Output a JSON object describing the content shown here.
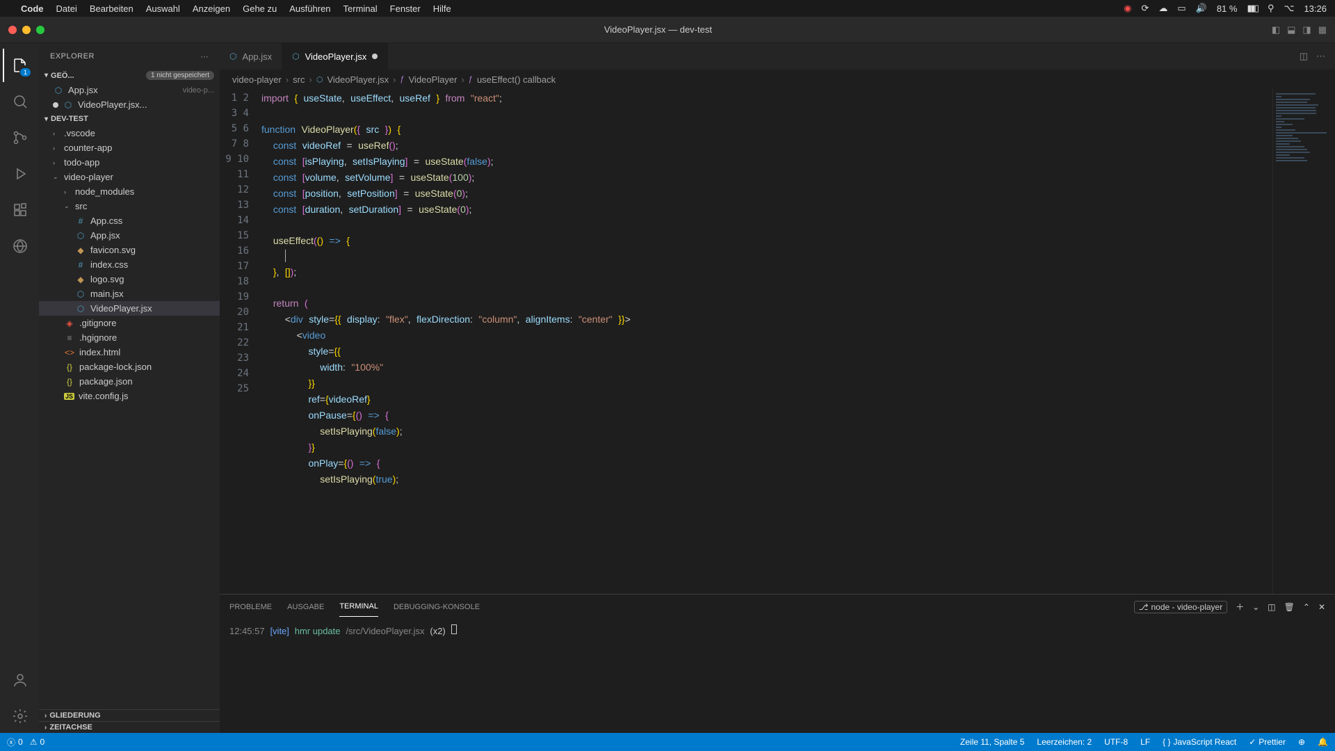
{
  "macos": {
    "app": "Code",
    "menus": [
      "Datei",
      "Bearbeiten",
      "Auswahl",
      "Anzeigen",
      "Gehe zu",
      "Ausführen",
      "Terminal",
      "Fenster",
      "Hilfe"
    ],
    "battery": "81 %",
    "time": "13:26"
  },
  "window": {
    "title": "VideoPlayer.jsx — dev-test"
  },
  "sidebar": {
    "title": "EXPLORER",
    "open_editors_label": "GEÖ...",
    "unsaved_badge": "1 nicht gespeichert",
    "open_editors": [
      {
        "label": "App.jsx",
        "sub": "video-p...",
        "dirty": false
      },
      {
        "label": "VideoPlayer.jsx...",
        "sub": "",
        "dirty": true
      }
    ],
    "workspace": "DEV-TEST",
    "tree": [
      {
        "type": "folder",
        "label": ".vscode",
        "indent": 1,
        "expanded": false
      },
      {
        "type": "folder",
        "label": "counter-app",
        "indent": 1,
        "expanded": false
      },
      {
        "type": "folder",
        "label": "todo-app",
        "indent": 1,
        "expanded": false
      },
      {
        "type": "folder",
        "label": "video-player",
        "indent": 1,
        "expanded": true
      },
      {
        "type": "folder",
        "label": "node_modules",
        "indent": 2,
        "expanded": false
      },
      {
        "type": "folder",
        "label": "src",
        "indent": 2,
        "expanded": true
      },
      {
        "type": "file",
        "label": "App.css",
        "indent": 3,
        "icon": "css"
      },
      {
        "type": "file",
        "label": "App.jsx",
        "indent": 3,
        "icon": "react"
      },
      {
        "type": "file",
        "label": "favicon.svg",
        "indent": 3,
        "icon": "svg"
      },
      {
        "type": "file",
        "label": "index.css",
        "indent": 3,
        "icon": "css"
      },
      {
        "type": "file",
        "label": "logo.svg",
        "indent": 3,
        "icon": "svg"
      },
      {
        "type": "file",
        "label": "main.jsx",
        "indent": 3,
        "icon": "react"
      },
      {
        "type": "file",
        "label": "VideoPlayer.jsx",
        "indent": 3,
        "icon": "react",
        "active": true
      },
      {
        "type": "file",
        "label": ".gitignore",
        "indent": 2,
        "icon": "git"
      },
      {
        "type": "file",
        "label": ".hgignore",
        "indent": 2,
        "icon": "txt"
      },
      {
        "type": "file",
        "label": "index.html",
        "indent": 2,
        "icon": "html"
      },
      {
        "type": "file",
        "label": "package-lock.json",
        "indent": 2,
        "icon": "json"
      },
      {
        "type": "file",
        "label": "package.json",
        "indent": 2,
        "icon": "json"
      },
      {
        "type": "file",
        "label": "vite.config.js",
        "indent": 2,
        "icon": "js"
      }
    ],
    "outline": "GLIEDERUNG",
    "timeline": "ZEITACHSE"
  },
  "tabs": [
    {
      "label": "App.jsx",
      "active": false,
      "dirty": false
    },
    {
      "label": "VideoPlayer.jsx",
      "active": true,
      "dirty": true
    }
  ],
  "breadcrumb": [
    "video-player",
    "src",
    "VideoPlayer.jsx",
    "VideoPlayer",
    "useEffect() callback"
  ],
  "code": {
    "lines": [
      1,
      2,
      3,
      4,
      5,
      6,
      7,
      8,
      9,
      10,
      11,
      12,
      13,
      14,
      15,
      16,
      17,
      18,
      19,
      20,
      21,
      22,
      23,
      24,
      25
    ]
  },
  "panel": {
    "tabs": [
      "PROBLEME",
      "AUSGABE",
      "TERMINAL",
      "DEBUGGING-KONSOLE"
    ],
    "active_tab": "TERMINAL",
    "task_label": "node - video-player",
    "terminal": {
      "time": "12:45:57",
      "tag": "[vite]",
      "msg": "hmr update",
      "path": "/src/VideoPlayer.jsx",
      "count": "(x2)"
    }
  },
  "status": {
    "errors": "0",
    "warnings": "0",
    "cursor": "Zeile 11, Spalte 5",
    "spaces": "Leerzeichen: 2",
    "encoding": "UTF-8",
    "eol": "LF",
    "lang": "JavaScript React",
    "prettier": "Prettier"
  }
}
